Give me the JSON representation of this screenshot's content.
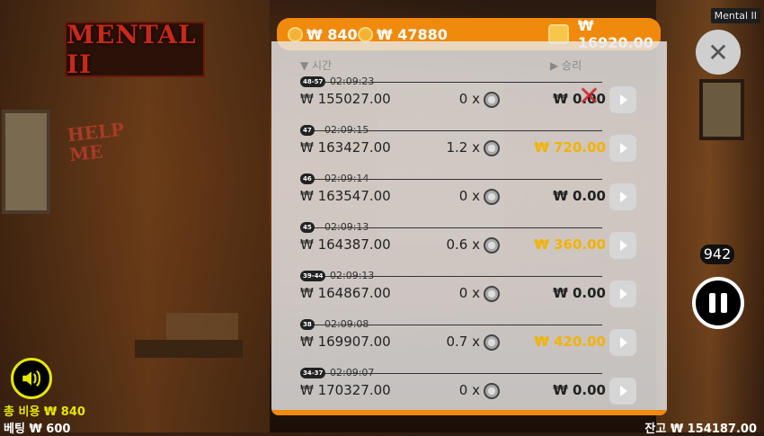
{
  "window_title": "Mental II",
  "logo_text": "MENTAL II",
  "graffiti": [
    "HELP",
    "ME"
  ],
  "topbar": {
    "coins_small": "₩ 840",
    "coins_large": "₩ 47880",
    "wallet": "₩ 16920.00"
  },
  "history": {
    "col_time": "▼ 시간",
    "col_win": "▶ 승리",
    "rows": [
      {
        "badge": "48-57",
        "time": "02:09:23",
        "bet": "₩ 155027.00",
        "mult": "0 x",
        "win": "₩ 0.00",
        "crossed": true
      },
      {
        "badge": "47",
        "time": "02:09:15",
        "bet": "₩ 163427.00",
        "mult": "1.2 x",
        "win": "₩ 720.00",
        "highlight": true
      },
      {
        "badge": "46",
        "time": "02:09:14",
        "bet": "₩ 163547.00",
        "mult": "0 x",
        "win": "₩ 0.00"
      },
      {
        "badge": "45",
        "time": "02:09:13",
        "bet": "₩ 164387.00",
        "mult": "0.6 x",
        "win": "₩ 360.00",
        "highlight": true
      },
      {
        "badge": "39-44",
        "time": "02:09:13",
        "bet": "₩ 164867.00",
        "mult": "0 x",
        "win": "₩ 0.00"
      },
      {
        "badge": "38",
        "time": "02:09:08",
        "bet": "₩ 169907.00",
        "mult": "0.7 x",
        "win": "₩ 420.00",
        "highlight": true
      },
      {
        "badge": "34-37",
        "time": "02:09:07",
        "bet": "₩ 170327.00",
        "mult": "0 x",
        "win": "₩ 0.00"
      }
    ]
  },
  "counter": "942",
  "footer": {
    "total_cost": "총 비용  ₩ 840",
    "betting": "베팅  ₩ 600",
    "balance": "잔고  ₩ 154187.00"
  },
  "colors": {
    "accent": "#f08a0c",
    "win_gold": "#f2b300",
    "sound_ring": "#e6e600"
  }
}
